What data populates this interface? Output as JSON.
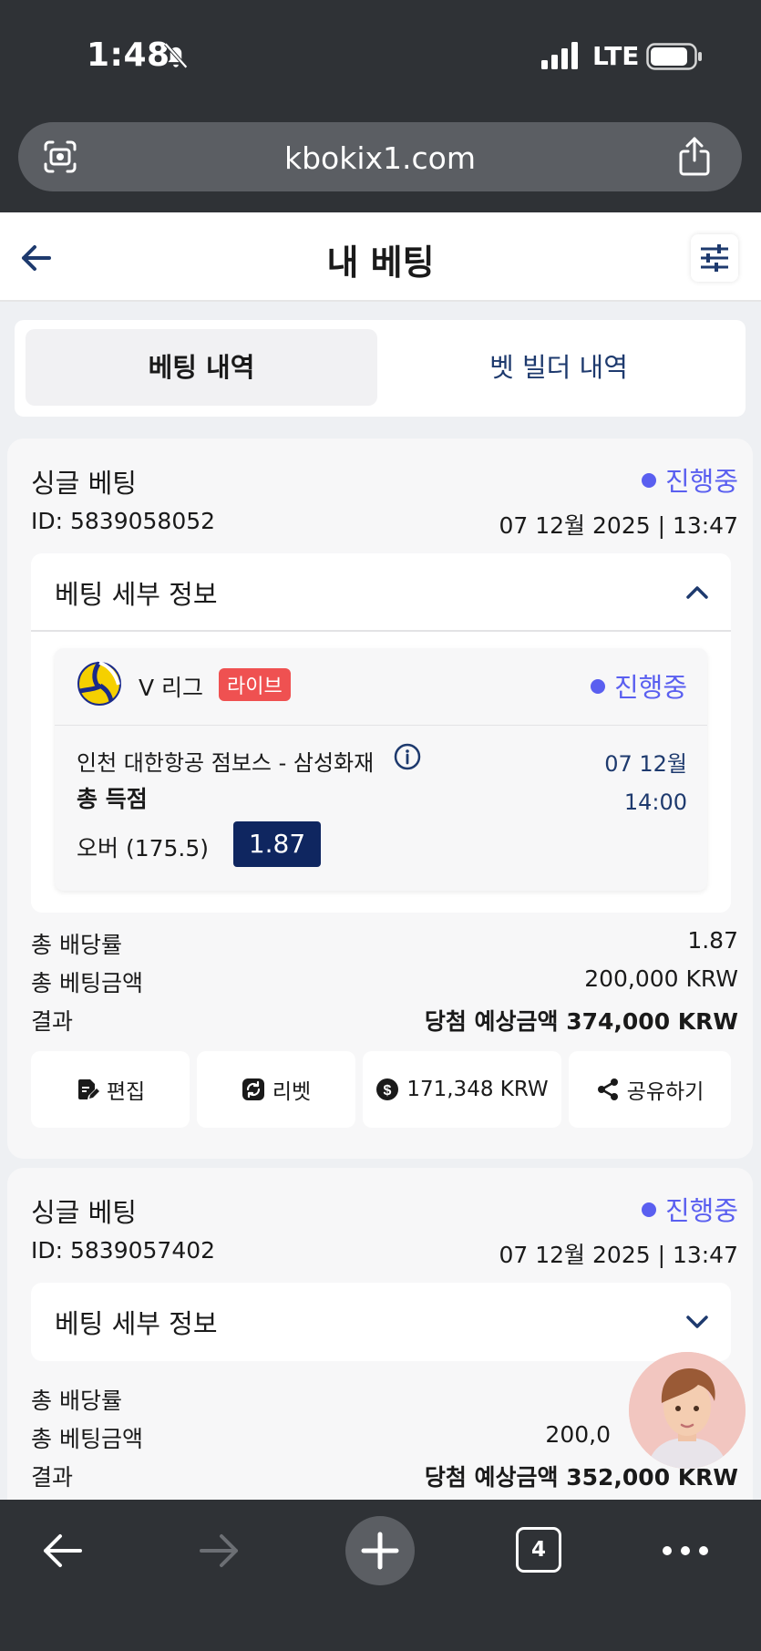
{
  "status_bar": {
    "time": "1:48",
    "network": "LTE"
  },
  "browser": {
    "url": "kbokix1.com",
    "tab_count": "4"
  },
  "header": {
    "title": "내 베팅"
  },
  "tabs": [
    {
      "label": "베팅 내역",
      "active": true
    },
    {
      "label": "벳 빌더 내역",
      "active": false
    }
  ],
  "bets": [
    {
      "type": "싱글 베팅",
      "status": "진행중",
      "id": "ID: 5839058052",
      "date": "07 12월 2025 | 13:47",
      "details_label": "베팅 세부 정보",
      "expanded": true,
      "selection": {
        "league": "V 리그",
        "live_badge": "라이브",
        "status": "진행중",
        "teams": "인천 대한항공 점보스 - 삼성화재",
        "match_date": "07 12월",
        "match_time": "14:00",
        "market": "총 득점",
        "pick": "오버 (175.5)",
        "odds": "1.87"
      },
      "summary": {
        "total_odds_label": "총 배당률",
        "total_odds": "1.87",
        "stake_label": "총 베팅금액",
        "stake": "200,000 KRW",
        "result_label": "결과",
        "result": "당첨 예상금액 374,000 KRW"
      },
      "actions": {
        "edit": "편집",
        "rebet": "리벳",
        "cashout": "171,348 KRW",
        "share": "공유하기"
      }
    },
    {
      "type": "싱글 베팅",
      "status": "진행중",
      "id": "ID: 5839057402",
      "date": "07 12월 2025 | 13:47",
      "details_label": "베팅 세부 정보",
      "expanded": false,
      "summary": {
        "total_odds_label": "총 배당률",
        "stake_label": "총 베팅금액",
        "stake": "200,0",
        "result_label": "결과",
        "result": "당첨 예상금액 352,000 KRW"
      }
    }
  ],
  "colors": {
    "accent": "#5a5ff0",
    "odds_bg": "#0f2660",
    "live": "#ef5151",
    "link": "#1e3a6e"
  }
}
